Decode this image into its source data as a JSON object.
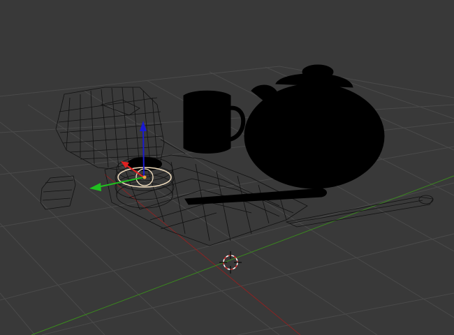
{
  "viewport": {
    "mode": "3d-view",
    "shading": "mixed-solid-wireframe",
    "background_color": "#393939",
    "grid_color": "#4a4a4a",
    "x_axis_color": "#8a2323",
    "y_axis_color": "#3a8a1d"
  },
  "scene_objects": [
    {
      "name": "tissue-box",
      "shading": "wireframe"
    },
    {
      "name": "mug",
      "shading": "solid"
    },
    {
      "name": "teapot",
      "shading": "solid"
    },
    {
      "name": "paper-sheet",
      "shading": "wireframe"
    },
    {
      "name": "pen",
      "shading": "solid"
    },
    {
      "name": "pencil",
      "shading": "wireframe"
    },
    {
      "name": "eraser",
      "shading": "wireframe"
    },
    {
      "name": "cup-ring",
      "shading": "wireframe",
      "selected": true
    }
  ],
  "gizmo": {
    "type": "translate",
    "x_color": "#e02020",
    "y_color": "#20c020",
    "z_color": "#1a1ad0",
    "pivot_color": "#f0a040",
    "ring_color": "#f4e0c0"
  },
  "cursor_3d": {
    "ring_colors": [
      "#ffffff",
      "#e03030"
    ]
  }
}
